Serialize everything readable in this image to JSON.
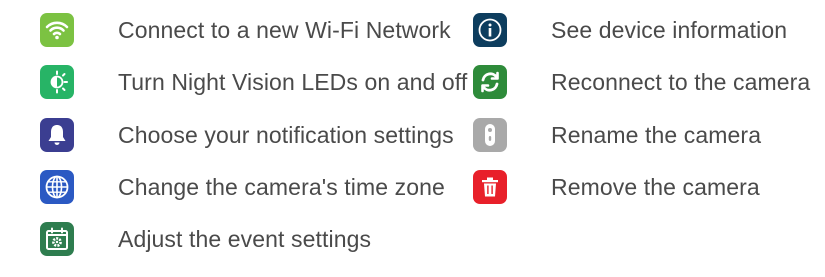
{
  "colors": {
    "text": "#4a4a4a",
    "wifi": "#7cc242",
    "night_vision": "#27b466",
    "notification": "#3b3e91",
    "time_zone": "#2b59c3",
    "event": "#2e7d4f",
    "device_info": "#0d3d5e",
    "reconnect": "#2e8b3a",
    "rename": "#a9a9a9",
    "remove": "#e8202a"
  },
  "left_items": [
    {
      "icon": "wifi-icon",
      "label": "Connect to a new Wi-Fi Network"
    },
    {
      "icon": "night-vision-icon",
      "label": "Turn Night Vision LEDs on and off"
    },
    {
      "icon": "bell-icon",
      "label": "Choose your notification settings"
    },
    {
      "icon": "globe-icon",
      "label": "Change the camera's time zone"
    },
    {
      "icon": "calendar-gear-icon",
      "label": "Adjust the event settings"
    }
  ],
  "right_items": [
    {
      "icon": "info-icon",
      "label": "See device information"
    },
    {
      "icon": "refresh-icon",
      "label": "Reconnect to the camera"
    },
    {
      "icon": "camera-device-icon",
      "label": "Rename the camera"
    },
    {
      "icon": "trash-icon",
      "label": "Remove the camera"
    }
  ]
}
